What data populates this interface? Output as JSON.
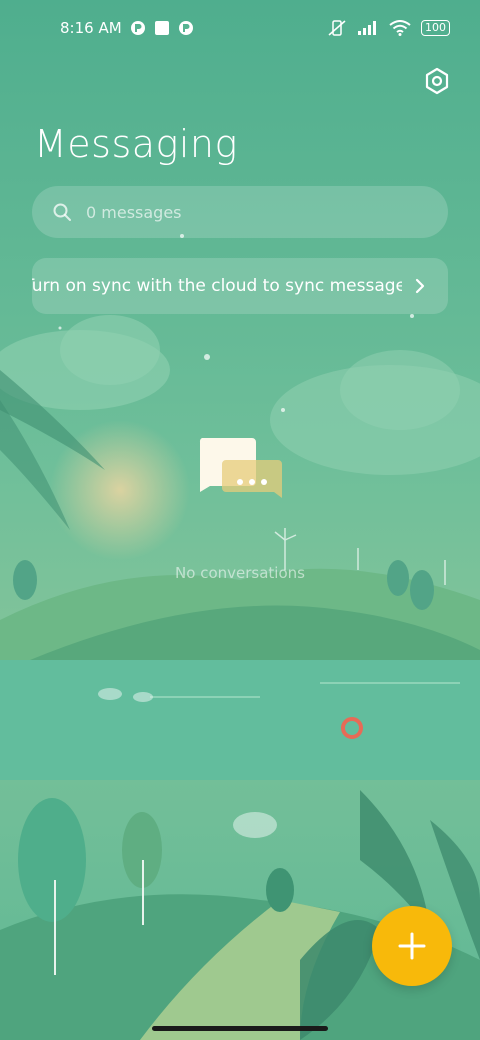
{
  "status_bar": {
    "time": "8:16 AM",
    "battery": "100"
  },
  "header": {
    "title": "Messaging"
  },
  "search": {
    "placeholder": "0 messages"
  },
  "sync_banner": {
    "text": "Turn on sync with the cloud to sync messages"
  },
  "empty_state": {
    "label": "No conversations"
  },
  "colors": {
    "background": "#56b492",
    "accent": "#f8b90a"
  },
  "icons": {
    "settings": "settings-hex-icon",
    "search": "search-icon",
    "chevron": "chevron-right-icon",
    "fab": "plus-icon",
    "empty": "chat-bubbles-icon"
  }
}
